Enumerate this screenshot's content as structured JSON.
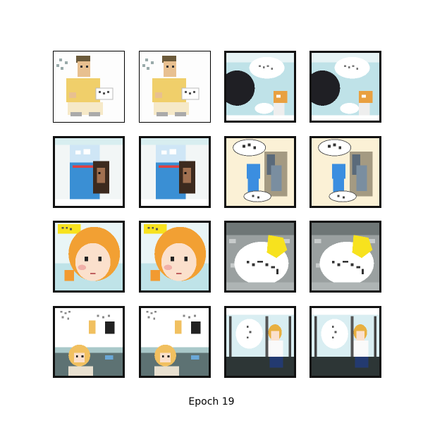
{
  "figure": {
    "caption": "Epoch 19",
    "rows": 4,
    "cols": 4
  },
  "tiles": [
    {
      "row": 0,
      "col": 0,
      "scene": "man-yellow-shirt",
      "border": "thin"
    },
    {
      "row": 0,
      "col": 1,
      "scene": "man-yellow-shirt",
      "border": "thin"
    },
    {
      "row": 0,
      "col": 2,
      "scene": "dark-head-speech",
      "border": "thick"
    },
    {
      "row": 0,
      "col": 3,
      "scene": "dark-head-speech",
      "border": "thick"
    },
    {
      "row": 1,
      "col": 0,
      "scene": "blue-book-face",
      "border": "thick"
    },
    {
      "row": 1,
      "col": 1,
      "scene": "blue-book-face",
      "border": "thick"
    },
    {
      "row": 1,
      "col": 2,
      "scene": "door-speech",
      "border": "thick"
    },
    {
      "row": 1,
      "col": 3,
      "scene": "door-speech",
      "border": "thick"
    },
    {
      "row": 2,
      "col": 0,
      "scene": "orange-girl",
      "border": "thick"
    },
    {
      "row": 2,
      "col": 1,
      "scene": "orange-girl",
      "border": "thick"
    },
    {
      "row": 2,
      "col": 2,
      "scene": "gray-room-bubble",
      "border": "thick"
    },
    {
      "row": 2,
      "col": 3,
      "scene": "gray-room-bubble",
      "border": "thick"
    },
    {
      "row": 3,
      "col": 0,
      "scene": "blonde-girl-text",
      "border": "thick"
    },
    {
      "row": 3,
      "col": 1,
      "scene": "blonde-girl-text",
      "border": "thick"
    },
    {
      "row": 3,
      "col": 2,
      "scene": "train-girl",
      "border": "thick"
    },
    {
      "row": 3,
      "col": 3,
      "scene": "train-girl",
      "border": "thick"
    }
  ]
}
